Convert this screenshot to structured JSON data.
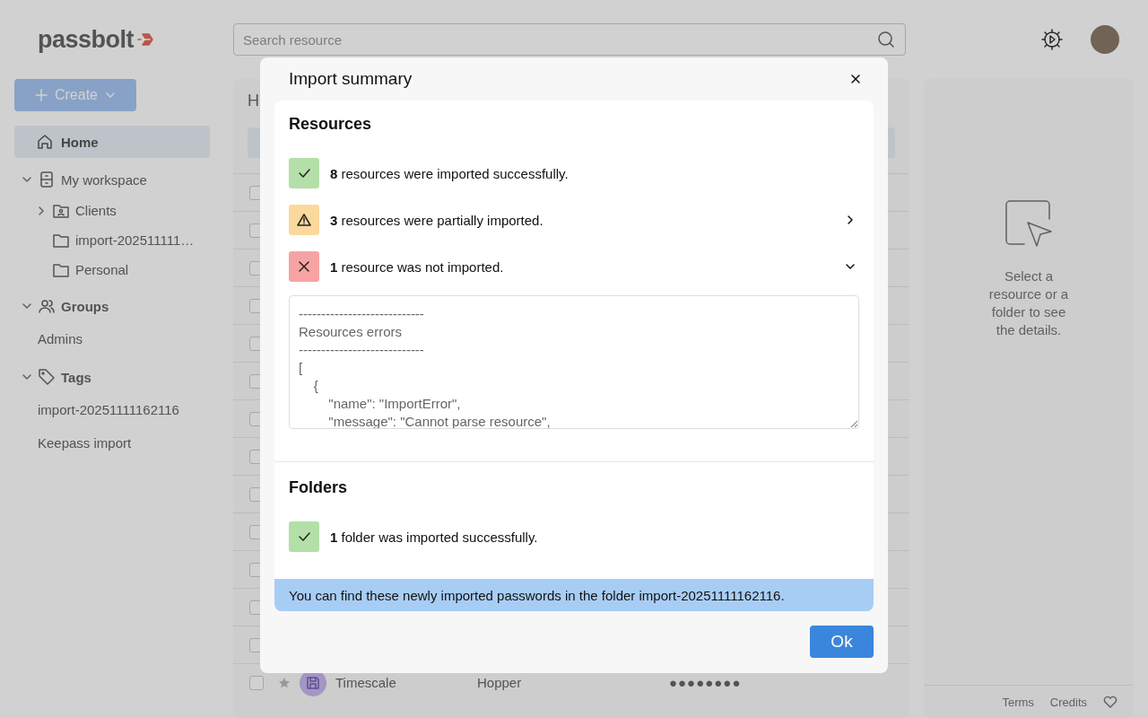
{
  "header": {
    "logo": "passbolt",
    "search": {
      "placeholder": "Search resource"
    }
  },
  "sidebar": {
    "create_button": "Create",
    "home": {
      "label": "Home",
      "selected": true
    },
    "sections": [
      {
        "label": "My workspace",
        "kind": "workspace",
        "expanded": true,
        "children": [
          {
            "label": "Clients",
            "kind": "shared-folder",
            "expanded": false
          },
          {
            "label": "import-202511111…",
            "kind": "folder"
          },
          {
            "label": "Personal",
            "kind": "folder"
          }
        ]
      },
      {
        "label": "Groups",
        "kind": "groups",
        "expanded": true,
        "children": [
          {
            "label": "Admins",
            "kind": "plain"
          }
        ]
      },
      {
        "label": "Tags",
        "kind": "tags",
        "expanded": true,
        "children": [
          {
            "label": "import-20251111162116",
            "kind": "plain"
          },
          {
            "label": "Keepass import",
            "kind": "plain"
          }
        ]
      }
    ]
  },
  "main": {
    "heading": "H",
    "rows": [
      {
        "checked": false
      },
      {
        "checked": false
      },
      {
        "checked": false
      },
      {
        "checked": false
      },
      {
        "checked": false
      },
      {
        "checked": false
      },
      {
        "checked": false
      },
      {
        "checked": false
      },
      {
        "checked": false
      },
      {
        "checked": false
      },
      {
        "checked": false
      },
      {
        "checked": false
      },
      {
        "checked": false
      },
      {
        "checked": false,
        "favorite": false,
        "name": "Timescale",
        "username": "Hopper",
        "password": "●●●●●●●●"
      }
    ]
  },
  "details": {
    "empty_text": "Select a resource or a folder to see the details."
  },
  "footer": {
    "links": [
      "Terms",
      "Credits"
    ]
  },
  "dialog": {
    "title": "Import summary",
    "sections": [
      {
        "heading": "Resources",
        "items": [
          {
            "kind": "success",
            "text": "**8** resources were imported successfully."
          },
          {
            "kind": "warning",
            "text": "**3** resources were partially imported.",
            "expanded": false
          },
          {
            "kind": "error",
            "text": "**1** resource was not imported.",
            "expanded": true,
            "details": "----------------------------\nResources errors\n----------------------------\n[\n    {\n        \"name\": \"ImportError\",\n        \"message\": \"Cannot parse resource\","
          }
        ]
      },
      {
        "heading": "Folders",
        "items": [
          {
            "kind": "success",
            "text": "**1** folder was imported successfully."
          }
        ]
      }
    ],
    "info": "You can find these newly imported passwords in the folder import-20251111162116.",
    "ok_button": "Ok"
  }
}
